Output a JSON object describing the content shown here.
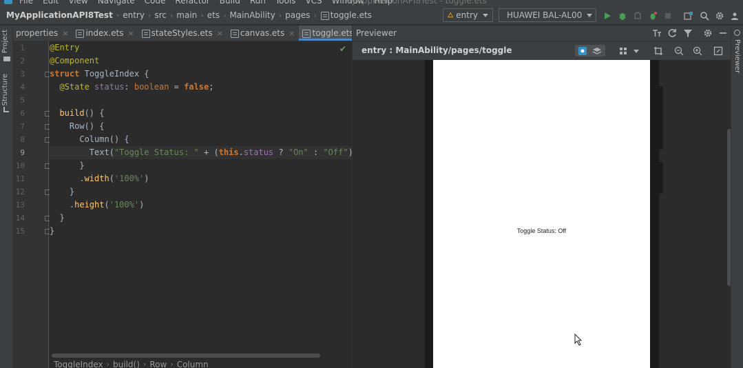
{
  "menu": {
    "items": [
      "File",
      "Edit",
      "View",
      "Navigate",
      "Code",
      "Refactor",
      "Build",
      "Run",
      "Tools",
      "VCS",
      "Window",
      "Help"
    ],
    "window_title": "MyApplicationAPI8Test - toggle.ets"
  },
  "navbar": {
    "breadcrumbs": [
      "MyApplicationAPI8Test",
      "entry",
      "src",
      "main",
      "ets",
      "MainAbility",
      "pages",
      "toggle.ets"
    ],
    "run_config": "entry",
    "device": "HUAWEI BAL-AL00"
  },
  "left_tools": {
    "project": "Project",
    "structure": "Structure"
  },
  "right_tools": {
    "previewer": "Previewer"
  },
  "tabs": [
    {
      "label": "properties",
      "active": false
    },
    {
      "label": "index.ets",
      "active": false
    },
    {
      "label": "stateStyles.ets",
      "active": false
    },
    {
      "label": "canvas.ets",
      "active": false
    },
    {
      "label": "toggle.ets",
      "active": true
    }
  ],
  "editor": {
    "line_numbers": [
      "1",
      "2",
      "3",
      "4",
      "5",
      "6",
      "7",
      "8",
      "9",
      "10",
      "11",
      "12",
      "13",
      "14",
      "15"
    ],
    "current_line": 9,
    "breadcrumb": [
      "ToggleIndex",
      "build()",
      "Row",
      "Column"
    ]
  },
  "previewer": {
    "panel_title": "Previewer",
    "page_path": "entry : MainAbility/pages/toggle",
    "screen_text": "Toggle Status: Off"
  },
  "colors": {
    "editor_bg": "#2b2b2b",
    "panel_bg": "#3c3f41",
    "accent": "#4a88c7",
    "run_green": "#499c54",
    "keyword": "#cc7832",
    "string": "#6a8759",
    "annotation": "#bbb529"
  }
}
